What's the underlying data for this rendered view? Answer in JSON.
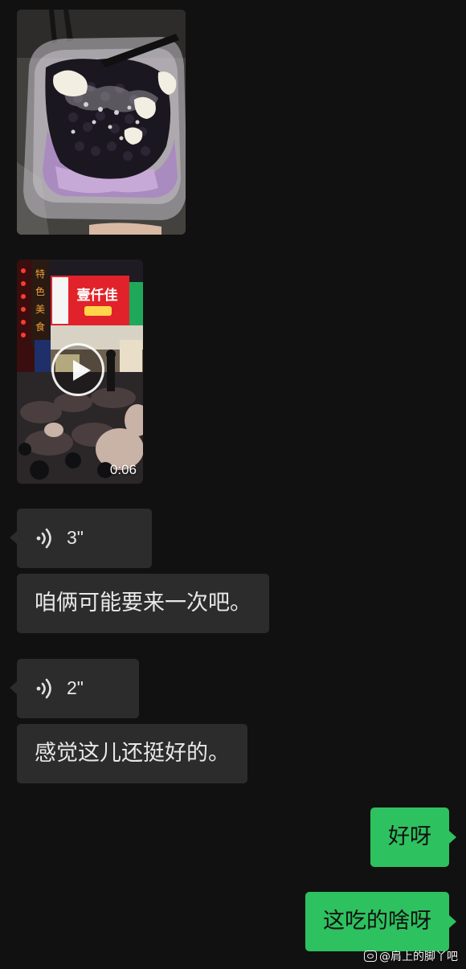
{
  "chat": {
    "video": {
      "duration": "0:06",
      "shop_sign": "壹仟佳",
      "side_sign": "特色美食"
    },
    "voice_messages": [
      {
        "duration": "3\""
      },
      {
        "duration": "2\""
      }
    ],
    "incoming_texts": [
      "咱俩可能要来一次吧。",
      "感觉这儿还挺好的。"
    ],
    "outgoing_texts": [
      "好呀",
      "这吃的啥呀"
    ]
  },
  "watermark": {
    "text": "@肩上的脚丫吧"
  },
  "colors": {
    "background": "#111111",
    "incoming_bubble": "#2c2c2c",
    "outgoing_bubble": "#2ec15f"
  }
}
